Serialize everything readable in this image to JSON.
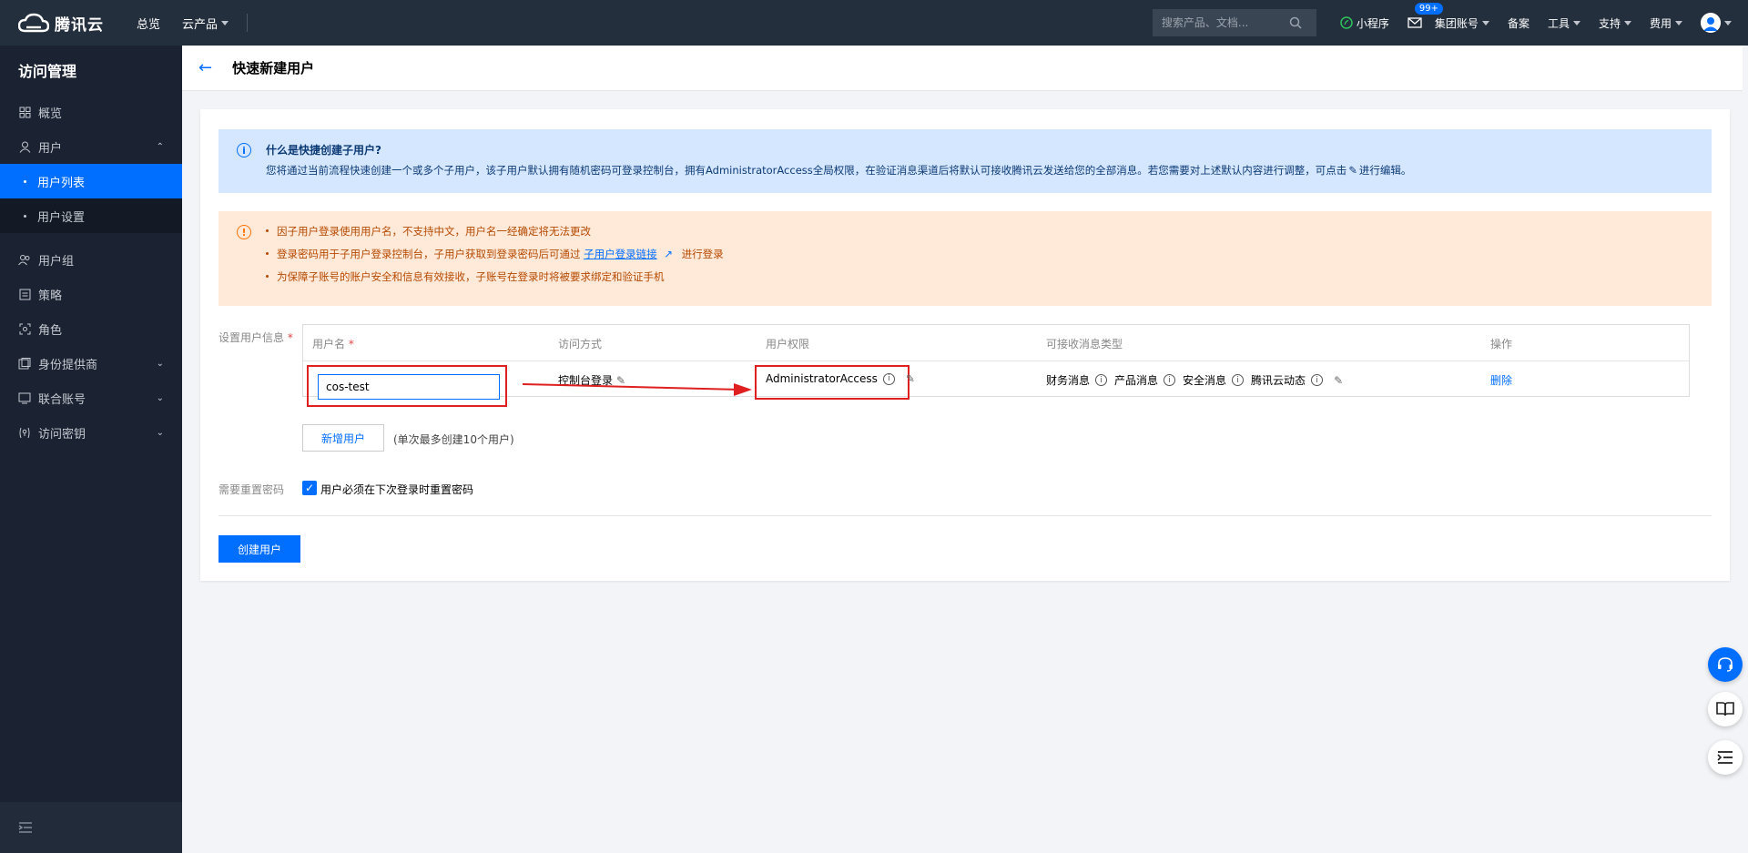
{
  "topnav": {
    "brand": "腾讯云",
    "overview": "总览",
    "products": "云产品",
    "search_placeholder": "搜索产品、文档...",
    "miniprogram": "小程序",
    "mail_badge": "99+",
    "group_account": "集团账号",
    "beian": "备案",
    "tools": "工具",
    "support": "支持",
    "billing": "费用"
  },
  "sidebar": {
    "title": "访问管理",
    "items": [
      {
        "label": "概览",
        "icon": "grid-icon"
      },
      {
        "label": "用户",
        "icon": "user-icon",
        "expanded": true
      },
      {
        "label": "用户列表",
        "sub": true,
        "active": true
      },
      {
        "label": "用户设置",
        "sub": true
      },
      {
        "label": "用户组",
        "icon": "users-icon"
      },
      {
        "label": "策略",
        "icon": "policy-icon"
      },
      {
        "label": "角色",
        "icon": "role-icon"
      },
      {
        "label": "身份提供商",
        "icon": "identity-icon"
      },
      {
        "label": "联合账号",
        "icon": "federated-icon"
      },
      {
        "label": "访问密钥",
        "icon": "key-icon"
      }
    ]
  },
  "page": {
    "title": "快速新建用户"
  },
  "info_blue": {
    "title": "什么是快捷创建子用户?",
    "text_before_pencil": "您将通过当前流程快速创建一个或多个子用户，该子用户默认拥有随机密码可登录控制台，拥有AdministratorAccess全局权限，在验证消息渠道后将默认可接收腾讯云发送给您的全部消息。若您需要对上述默认内容进行调整，可点击",
    "text_after_pencil": "进行编辑。"
  },
  "info_orange": {
    "line1": "因子用户登录使用用户名，不支持中文，用户名一经确定将无法更改",
    "line2_before": "登录密码用于子用户登录控制台，子用户获取到登录密码后可通过",
    "line2_link": "子用户登录链接",
    "line2_after": "进行登录",
    "line3": "为保障子账号的账户安全和信息有效接收，子账号在登录时将被要求绑定和验证手机"
  },
  "form": {
    "user_info_label": "设置用户信息",
    "required_mark": "*",
    "table_headers": {
      "username": "用户名",
      "access": "访问方式",
      "permission": "用户权限",
      "messages": "可接收消息类型",
      "action": "操作"
    },
    "row": {
      "username": "cos-test",
      "access": "控制台登录",
      "permission": "AdministratorAccess",
      "msg1": "财务消息",
      "msg2": "产品消息",
      "msg3": "安全消息",
      "msg4": "腾讯云动态",
      "delete": "删除"
    },
    "add_user": "新增用户",
    "add_note": "(单次最多创建10个用户)",
    "reset_label": "需要重置密码",
    "reset_checkbox": "用户必须在下次登录时重置密码",
    "create_button": "创建用户"
  },
  "colors": {
    "accent": "#006eff",
    "nav_bg": "#242f3d",
    "sidebar_bg": "#1b2231",
    "highlight_red": "#e02020"
  }
}
